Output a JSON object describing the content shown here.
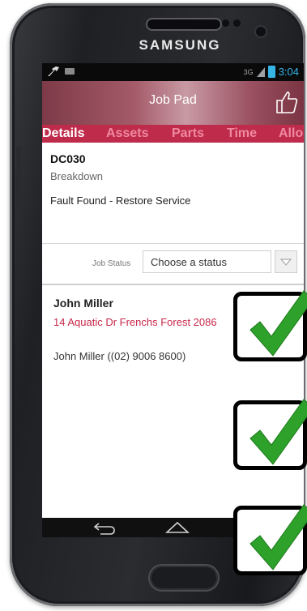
{
  "device": {
    "brand": "SAMSUNG"
  },
  "statusbar": {
    "network": "3G",
    "time": "3:04",
    "accent": "#36b4e6"
  },
  "app": {
    "title": "Job Pad",
    "accent": "#bf2b4b"
  },
  "tabs": [
    {
      "label": "Details",
      "active": true
    },
    {
      "label": "Assets",
      "active": false
    },
    {
      "label": "Parts",
      "active": false
    },
    {
      "label": "Time",
      "active": false
    },
    {
      "label": "Allo",
      "active": false
    }
  ],
  "job": {
    "code": "DC030",
    "type": "Breakdown",
    "description": "Fault Found - Restore Service"
  },
  "job_status": {
    "label": "Job Status",
    "placeholder": "Choose a status"
  },
  "client": {
    "name": "John Miller",
    "address": "14 Aquatic Dr  Frenchs Forest 2086",
    "contact": "John Miller  ((02) 9006 8600)"
  },
  "overlay": {
    "checkmark_count": 3,
    "check_color": "#2ea12b"
  }
}
